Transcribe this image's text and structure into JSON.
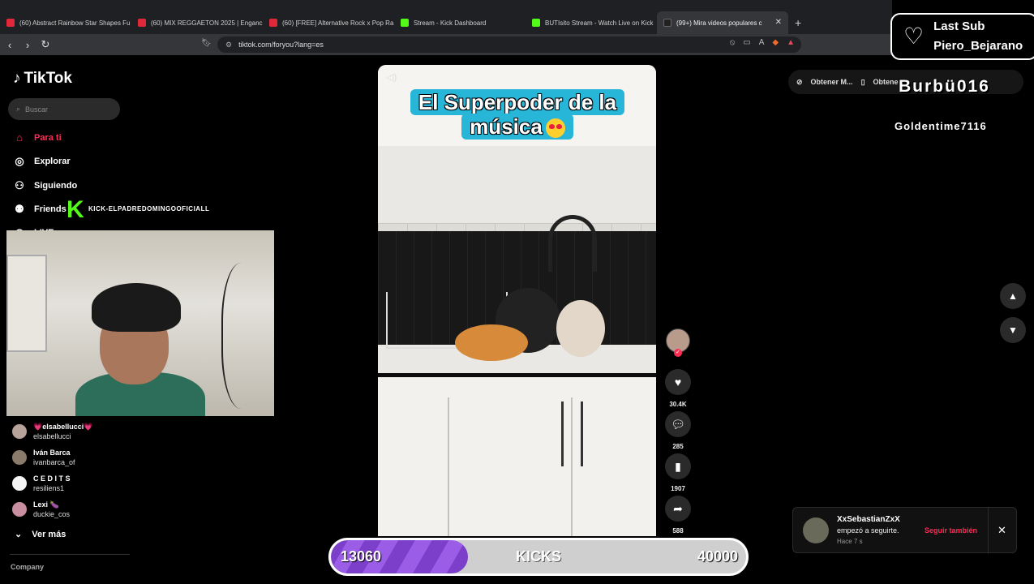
{
  "browser": {
    "tabs": [
      {
        "label": "(60) Abstract Rainbow Star Shapes Fu",
        "icon": "youtube-icon",
        "active": false
      },
      {
        "label": "(60) MIX REGGAETON 2025 | Enganc",
        "icon": "youtube-icon",
        "active": false
      },
      {
        "label": "(60) [FREE] Alternative Rock x Pop Ra",
        "icon": "youtube-icon",
        "active": false
      },
      {
        "label": "Stream - Kick Dashboard",
        "icon": "kick-icon",
        "active": false
      },
      {
        "label": "BUTIsito Stream - Watch Live on Kick",
        "icon": "kick-icon",
        "active": false
      },
      {
        "label": "(99+) Mira videos populares c",
        "icon": "tiktok-icon",
        "active": true
      }
    ],
    "new_tab": "+",
    "url": "tiktok.com/foryou?lang=es"
  },
  "sidebar": {
    "logo": "TikTok",
    "search_placeholder": "Buscar",
    "nav": [
      {
        "label": "Para ti",
        "icon": "home-icon",
        "active": true
      },
      {
        "label": "Explorar",
        "icon": "compass-icon",
        "active": false
      },
      {
        "label": "Siguiendo",
        "icon": "following-icon",
        "active": false
      },
      {
        "label": "Friends",
        "icon": "friends-icon",
        "active": false
      },
      {
        "label": "LIVE",
        "icon": "live-icon",
        "active": false
      }
    ],
    "following": [
      {
        "display": "💗elsabellucci💗",
        "handle": "elsabellucci"
      },
      {
        "display": "Iván Barca",
        "handle": "ivanbarca_of"
      },
      {
        "display": "C E D I T S",
        "handle": "resiliens1"
      },
      {
        "display": "Lexi 🍆",
        "handle": "duckie_cos"
      }
    ],
    "see_more": "Ver más",
    "company": "Company"
  },
  "overlay": {
    "kick_username": "KICK-ELPADREDOMINGOOFICIALL",
    "last_sub_title": "Last Sub",
    "last_sub_name": "Piero_Bejarano",
    "streamer_tag": "Burbü016",
    "secondary_tag": "Goldentime7116",
    "kicks": {
      "current": "13060",
      "label": "KICKS",
      "goal": "40000",
      "progress": 0.33
    }
  },
  "video": {
    "caption_line1": "El Superpoder de la",
    "caption_line2": "música",
    "actions": {
      "likes": "30.4K",
      "comments": "285",
      "saves": "1907",
      "shares": "588"
    }
  },
  "get_app": {
    "label1": "Obtener M...",
    "label2": "Obtene"
  },
  "notification": {
    "user": "XxSebastianZxX",
    "message": "empezó a seguirte.",
    "time": "Hace 7 s",
    "action": "Seguir también"
  },
  "colors": {
    "accent": "#fe2c55",
    "kick": "#53fc18",
    "kicks_bar": "#7b3fc9"
  }
}
